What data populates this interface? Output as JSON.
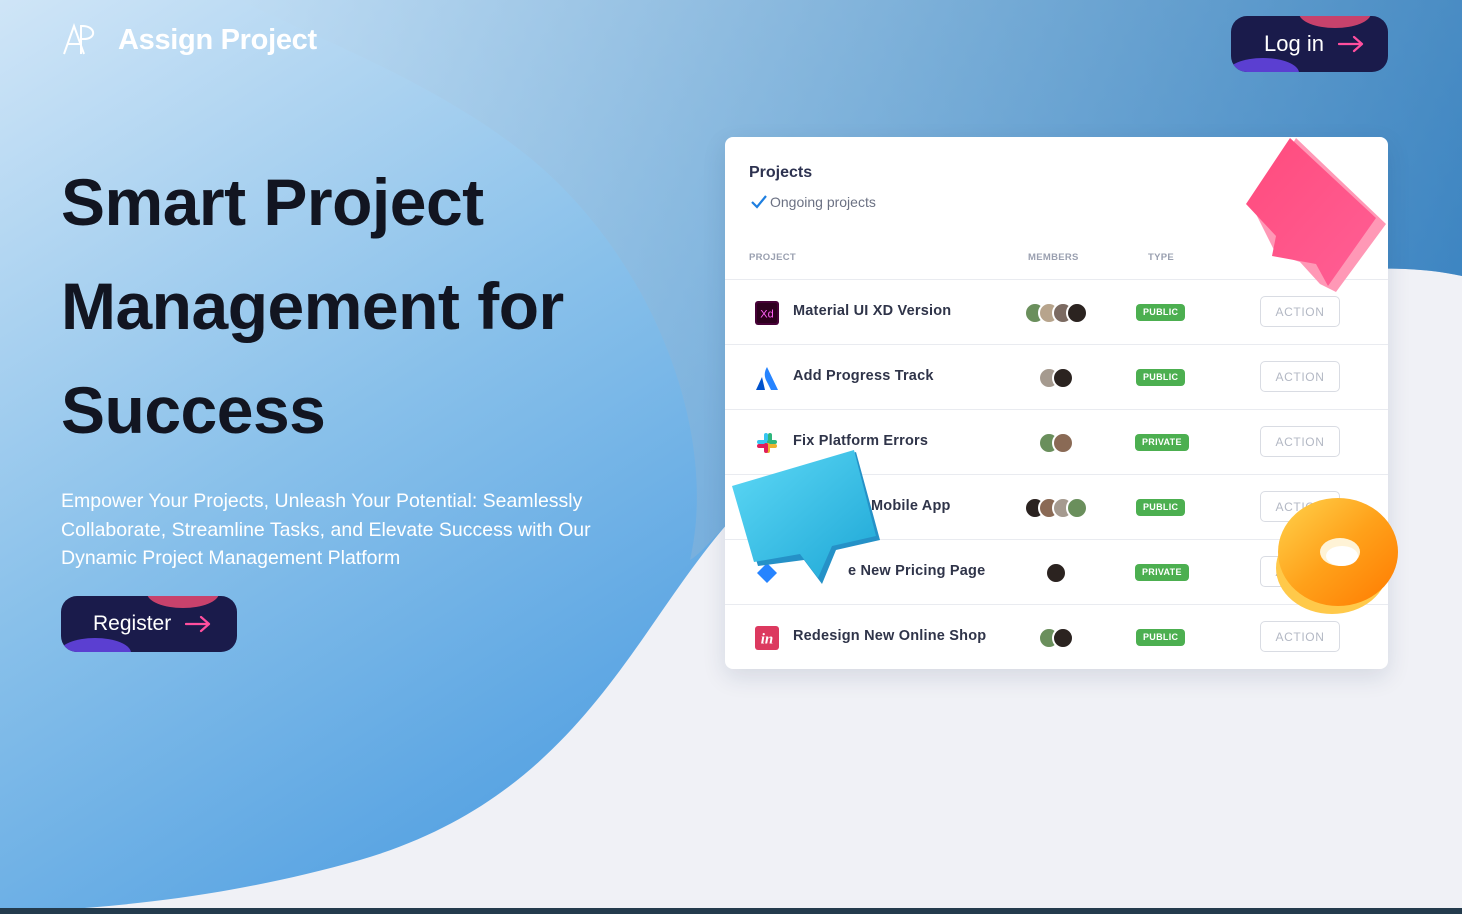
{
  "brand": {
    "name": "Assign Project",
    "logo_text": "AP"
  },
  "header": {
    "login_label": "Log in"
  },
  "hero": {
    "title": "Smart Project Management for Success",
    "subtitle": "Empower Your Projects, Unleash Your Potential: Seamlessly Collaborate, Streamline Tasks, and Elevate Success with Our Dynamic Project Management Platform",
    "register_label": "Register"
  },
  "card": {
    "title": "Projects",
    "subtitle": "Ongoing projects",
    "columns": {
      "project": "PROJECT",
      "members": "MEMBERS",
      "type": "TYPE"
    },
    "rows": [
      {
        "name": "Material UI XD Version",
        "icon": "xd-icon",
        "members": 4,
        "type": "PUBLIC",
        "action": "ACTION"
      },
      {
        "name": "Add Progress Track",
        "icon": "atlassian-icon",
        "members": 2,
        "type": "PUBLIC",
        "action": "ACTION"
      },
      {
        "name": "Fix Platform Errors",
        "icon": "slack-icon",
        "members": 2,
        "type": "PRIVATE",
        "action": "ACTION"
      },
      {
        "name": "Mobile App",
        "icon": "app-icon",
        "members": 4,
        "type": "PUBLIC",
        "action": "ACTION"
      },
      {
        "name": "e New Pricing Page",
        "icon": "jira-icon",
        "members": 1,
        "type": "PRIVATE",
        "action": "ACTION"
      },
      {
        "name": "Redesign New Online Shop",
        "icon": "invision-icon",
        "members": 2,
        "type": "PUBLIC",
        "action": "ACTION"
      }
    ]
  },
  "colors": {
    "primary_dark": "#1a1b4b",
    "accent_pink": "#c8426c",
    "accent_purple": "#5b3fd1",
    "badge_green": "#4caf50",
    "hero_blue": "#4aa3e6"
  }
}
